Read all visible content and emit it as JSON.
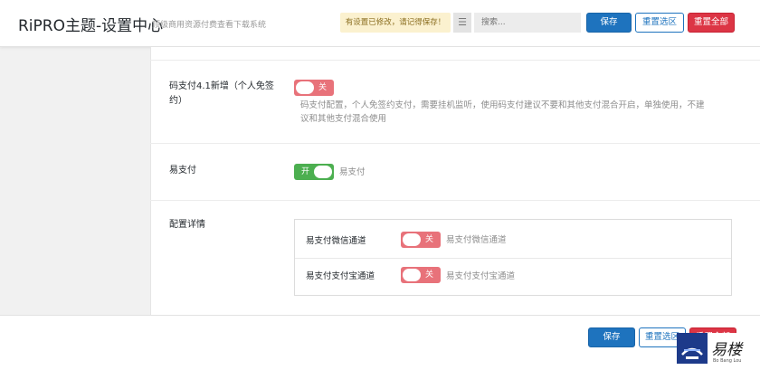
{
  "header": {
    "title": "RiPRO主题-设置中心",
    "subtitle": "顶级商用资源付费查看下载系统",
    "notice": "有设置已修改，请记得保存！",
    "expand_icon": "list-icon",
    "search_placeholder": "搜索...",
    "save_label": "保存",
    "reset_section_label": "重置选区",
    "reset_all_label": "重置全部"
  },
  "fields": {
    "codepay": {
      "label_line1": "码支付4.1新增（个人免签",
      "label_line2": "约）",
      "switch_text": "关",
      "switch_state": "off",
      "desc_line1": "码支付配置，个人免签约支付，需要挂机监听，使用码支付建议不要和其他支付混合开启，单独使用，不建",
      "desc_line2": "议和其他支付混合使用"
    },
    "epay": {
      "label": "易支付",
      "switch_text": "开",
      "switch_state": "on",
      "desc": "易支付"
    },
    "config": {
      "label": "配置详情",
      "wechat": {
        "label": "易支付微信通道",
        "switch_text": "关",
        "switch_state": "off",
        "desc": "易支付微信通道"
      },
      "alipay": {
        "label": "易支付支付宝通道",
        "switch_text": "关",
        "switch_state": "off",
        "desc": "易支付支付宝通道"
      }
    }
  },
  "footer": {
    "save_label": "保存",
    "reset_section_label": "重置选区",
    "reset_all_label": "重置全部"
  },
  "watermark": {
    "script": "易楼",
    "sub": "Bo Bang Lou"
  },
  "colors": {
    "primary": "#1e73be",
    "danger": "#dc3545",
    "switch_off": "#e8727a",
    "switch_on": "#4caf50",
    "notice_bg": "#fbf1cf"
  }
}
